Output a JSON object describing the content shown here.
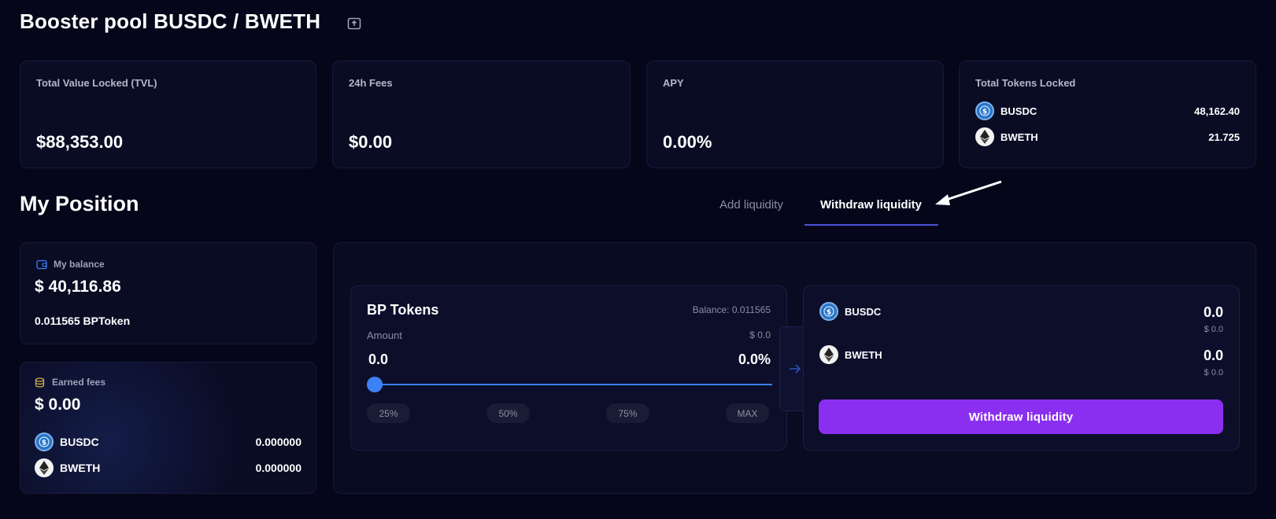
{
  "page": {
    "title": "Booster pool BUSDC / BWETH"
  },
  "stats": {
    "tvl": {
      "label": "Total Value Locked (TVL)",
      "value": "$88,353.00"
    },
    "fees": {
      "label": "24h Fees",
      "value": "$0.00"
    },
    "apy": {
      "label": "APY",
      "value": "0.00%"
    },
    "locked": {
      "label": "Total Tokens Locked",
      "tokens": [
        {
          "name": "BUSDC",
          "value": "48,162.40",
          "icon": "usdc-coin-icon"
        },
        {
          "name": "BWETH",
          "value": "21.725",
          "icon": "eth-coin-icon"
        }
      ]
    }
  },
  "position": {
    "title": "My Position",
    "tabs": [
      {
        "label": "Add liquidity",
        "active": false
      },
      {
        "label": "Withdraw liquidity",
        "active": true
      }
    ],
    "balance": {
      "label": "My balance",
      "value": "$ 40,116.86",
      "bp_tokens": "0.011565 BPToken"
    },
    "earned": {
      "label": "Earned fees",
      "value": "$ 0.00",
      "tokens": [
        {
          "name": "BUSDC",
          "value": "0.000000"
        },
        {
          "name": "BWETH",
          "value": "0.000000"
        }
      ]
    }
  },
  "withdraw": {
    "bp": {
      "title": "BP Tokens",
      "balance": "Balance: 0.011565",
      "amount_label": "Amount",
      "amount_usd": "$ 0.0",
      "amount": "0.0",
      "percent": "0.0%",
      "slider_fraction": 0,
      "chips": [
        "25%",
        "50%",
        "75%",
        "MAX"
      ]
    },
    "out": [
      {
        "name": "BUSDC",
        "amount": "0.0",
        "usd": "$ 0.0"
      },
      {
        "name": "BWETH",
        "amount": "0.0",
        "usd": "$ 0.0"
      }
    ],
    "button": "Withdraw liquidity"
  },
  "colors": {
    "background": "#05061a",
    "card": "#0a0c24",
    "accent": "#8a2ff0",
    "slider": "#3b82f6"
  }
}
